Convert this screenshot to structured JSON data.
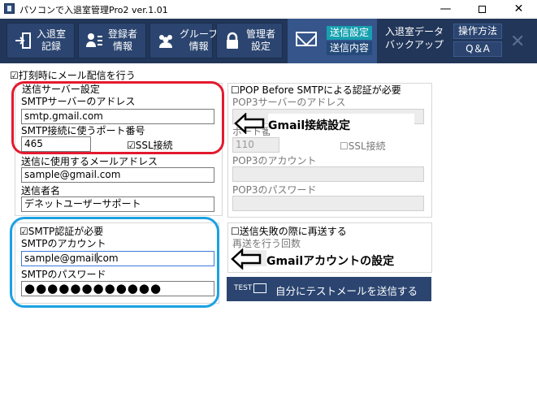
{
  "window": {
    "title": "パソコンで入退室管理Pro2 ver.1.01",
    "minimize": "—",
    "close": "✕"
  },
  "toolbar": {
    "buttons": [
      {
        "label1": "入退室",
        "label2": "記録"
      },
      {
        "label1": "登録者",
        "label2": "情報"
      },
      {
        "label1": "グループ",
        "label2": "情報"
      },
      {
        "label1": "管理者",
        "label2": "設定"
      }
    ],
    "send_settings": "送信設定",
    "send_contents": "送信内容",
    "backup1": "入退室データ",
    "backup2": "バックアップ",
    "howto": "操作方法",
    "qa": "Q＆A",
    "close_icon": "✕"
  },
  "main": {
    "distribute_checkbox": "☑打刻時にメール配信を行う",
    "server_section": "送信サーバー設定",
    "smtp_server_label": "SMTPサーバーのアドレス",
    "smtp_server_value": "smtp.gmail.com",
    "port_label": "SMTP接続に使うポート番号",
    "port_value": "465",
    "ssl_checkbox": "☑SSL接続",
    "sender_mail_label": "送信に使用するメールアドレス",
    "sender_mail_value": "sample@gmail.com",
    "sender_name_label": "送信者名",
    "sender_name_value": "デネットユーザーサポート",
    "smtp_auth_checkbox": "☑SMTP認証が必要",
    "smtp_account_label": "SMTPのアカウント",
    "smtp_account_value": "sample@gmail",
    "smtp_account_value_tail": "com",
    "smtp_password_label": "SMTPのパスワード",
    "smtp_password_value": "●●●●●●●●●●●●",
    "pop_checkbox": "☐POP Before SMTPによる認証が必要",
    "pop3_server_label": "POP3サーバーのアドレス",
    "pop3_port_label": "ポート番",
    "pop3_port_value": "110",
    "pop3_ssl": "☐SSL接続",
    "pop3_account_label": "POP3のアカウント",
    "pop3_password_label": "POP3のパスワード",
    "resend_checkbox": "☐送信失敗の際に再送する",
    "resend_count_label": "再送を行う回数",
    "test_small": "TEST",
    "test_button": "自分にテストメールを送信する"
  },
  "annotations": {
    "gmail_connection": "Gmail接続設定",
    "gmail_account": "Gmailアカウントの設定"
  },
  "colors": {
    "toolbar_bg": "#213659",
    "active_tab": "#17a1b0",
    "red_mark": "#e31a2e",
    "blue_mark": "#1ba1e2"
  }
}
